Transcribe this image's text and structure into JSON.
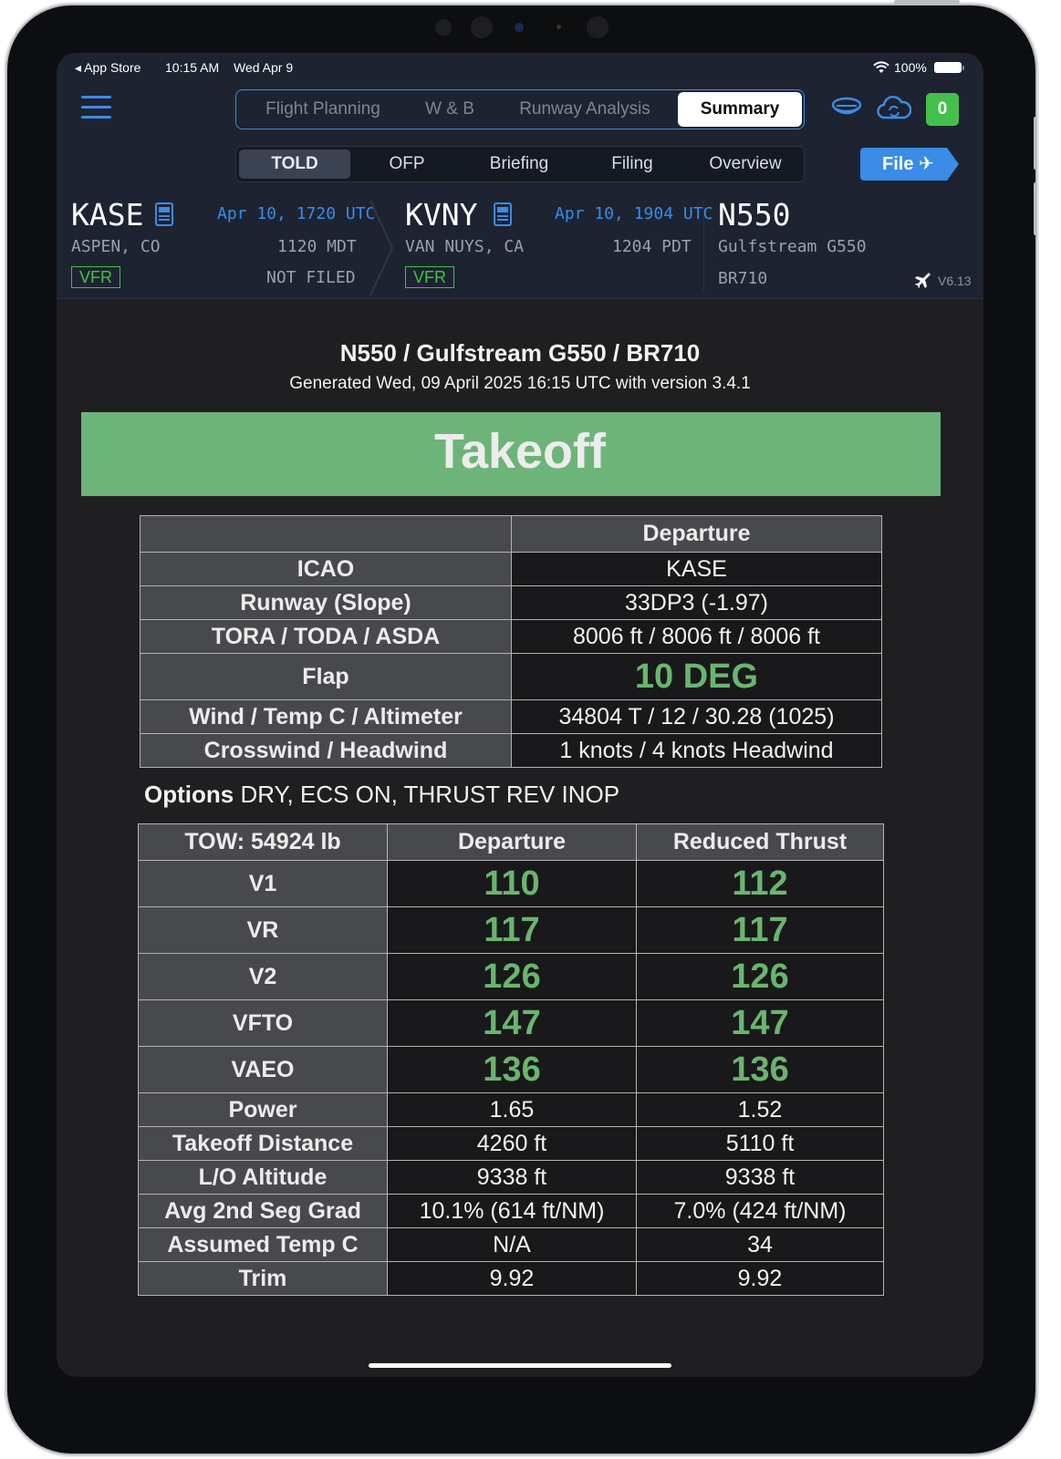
{
  "status_bar": {
    "back": "◂ App Store",
    "time": "10:15 AM",
    "date": "Wed Apr 9",
    "battery": "100%"
  },
  "nav": {
    "tabs": [
      "Flight Planning",
      "W & B",
      "Runway Analysis",
      "Summary"
    ],
    "selected_tab": "Summary",
    "subtabs": [
      "TOLD",
      "OFP",
      "Briefing",
      "Filing",
      "Overview"
    ],
    "selected_subtab": "TOLD",
    "badge_count": "0",
    "file_label": "File ✈"
  },
  "departure": {
    "code": "KASE",
    "city": "ASPEN, CO",
    "utc": "Apr 10, 1720 UTC",
    "local": "1120 MDT",
    "status": "NOT FILED",
    "rules": "VFR"
  },
  "arrival": {
    "code": "KVNY",
    "city": "VAN NUYS, CA",
    "utc": "Apr 10, 1904 UTC",
    "local": "1204 PDT",
    "rules": "VFR"
  },
  "aircraft": {
    "tail": "N550",
    "type": "Gulfstream G550",
    "engine": "BR710",
    "version": "V6.13"
  },
  "report": {
    "heading": "N550 / Gulfstream G550 / BR710",
    "generated": "Generated Wed, 09 April 2025 16:15 UTC with version 3.4.1",
    "banner": "Takeoff",
    "banner_color": "#6db479",
    "info_header": [
      "",
      "Departure"
    ],
    "info_rows": [
      {
        "label": "ICAO",
        "value": "KASE"
      },
      {
        "label": "Runway (Slope)",
        "value": "33DP3 (-1.97)"
      },
      {
        "label": "TORA / TODA / ASDA",
        "value": "8006 ft / 8006 ft / 8006 ft"
      },
      {
        "label": "Flap",
        "value": "10 DEG"
      },
      {
        "label": "Wind / Temp C / Altimeter",
        "value": "34804 T / 12 / 30.28 (1025)"
      },
      {
        "label": "Crosswind / Headwind",
        "value": "1 knots / 4 knots Headwind"
      }
    ],
    "options_label": "Options",
    "options_value": "DRY, ECS ON, THRUST REV INOP",
    "speed_header": [
      "TOW: 54924 lb",
      "Departure",
      "Reduced Thrust"
    ],
    "speed_rows": [
      {
        "label": "V1",
        "dep": "110",
        "red": "112"
      },
      {
        "label": "VR",
        "dep": "117",
        "red": "117"
      },
      {
        "label": "V2",
        "dep": "126",
        "red": "126"
      },
      {
        "label": "VFTO",
        "dep": "147",
        "red": "147"
      },
      {
        "label": "VAEO",
        "dep": "136",
        "red": "136"
      },
      {
        "label": "Power",
        "dep": "1.65",
        "red": "1.52"
      },
      {
        "label": "Takeoff Distance",
        "dep": "4260 ft",
        "red": "5110 ft"
      },
      {
        "label": "L/O Altitude",
        "dep": "9338 ft",
        "red": "9338 ft"
      },
      {
        "label": "Avg 2nd Seg Grad",
        "dep": "10.1% (614 ft/NM)",
        "red": "7.0% (424 ft/NM)"
      },
      {
        "label": "Assumed Temp C",
        "dep": "N/A",
        "red": "34"
      },
      {
        "label": "Trim",
        "dep": "9.92",
        "red": "9.92"
      }
    ]
  },
  "colors": {
    "accent": "#3a8ce6",
    "green": "#43c04b",
    "value_green": "#6ab56e"
  }
}
